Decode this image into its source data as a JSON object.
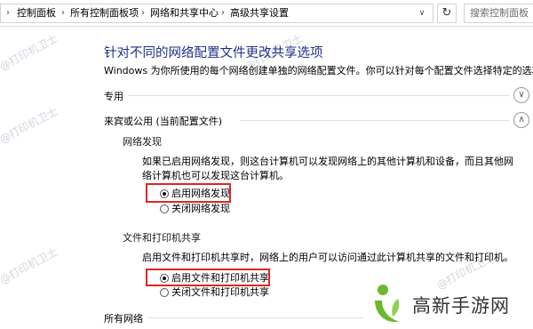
{
  "address_bar": {
    "crumbs": [
      "控制面板",
      "所有控制面板项",
      "网络和共享中心",
      "高级共享设置"
    ],
    "refresh_icon": "refresh-icon",
    "search_placeholder": "搜索控制面板"
  },
  "page": {
    "title": "针对不同的网络配置文件更改共享选项",
    "description": "Windows 为你所使用的每个网络创建单独的网络配置文件。你可以针对每个配置文件选择特定的选项。"
  },
  "profiles": {
    "private_label": "专用",
    "guest_public_label": "来宾或公用 (当前配置文件)",
    "all_networks_label": "所有网络"
  },
  "network_discovery": {
    "heading": "网络发现",
    "description": "如果已启用网络发现，则这台计算机可以发现网络上的其他计算机和设备，而且其他网络计算机也可以发现这台计算机。",
    "options": [
      "启用网络发现",
      "关闭网络发现"
    ],
    "selected": "启用网络发现"
  },
  "file_printer_sharing": {
    "heading": "文件和打印机共享",
    "description": "启用文件和打印机共享时，网络上的用户可以访问通过此计算机共享的文件和打印机。",
    "options": [
      "启用文件和打印机共享",
      "关闭文件和打印机共享"
    ],
    "selected": "启用文件和打印机共享"
  },
  "watermark": "@打印机卫士",
  "logo": {
    "text": "高新手游网"
  },
  "colors": {
    "title": "#1e3287",
    "highlight_box": "#e02525",
    "logo_green": "#6ab82e"
  }
}
